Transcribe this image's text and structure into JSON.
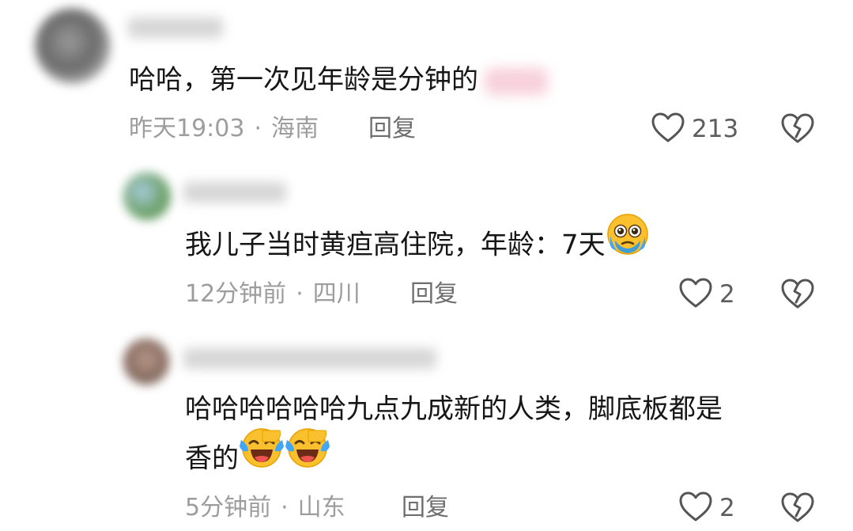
{
  "comments": [
    {
      "text": "哈哈，第一次见年龄是分钟的",
      "time": "昨天19:03",
      "location": "海南",
      "reply_label": "回复",
      "likes": "213",
      "avatar_color": "#7a7a7a"
    },
    {
      "text": "我儿子当时黄疸高住院，年龄：7天",
      "time": "12分钟前",
      "location": "四川",
      "reply_label": "回复",
      "likes": "2",
      "avatar_color": "#6fa36b",
      "emoji": "face-holding-back-tears-icon"
    },
    {
      "text_line1": "哈哈哈哈哈哈九点九成新的人类，脚底板都是",
      "text_line2": "香的",
      "time": "5分钟前",
      "location": "山东",
      "reply_label": "回复",
      "likes": "2",
      "avatar_color": "#8a6e63",
      "emoji": "laughing-crying-face-icon"
    }
  ],
  "separator": "·",
  "colors": {
    "meta_text": "#9d9d9d",
    "reply_text": "#6e6e6e",
    "body_text": "#161616"
  }
}
